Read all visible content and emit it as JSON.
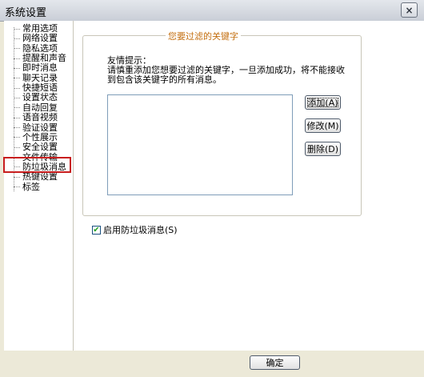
{
  "window": {
    "title": "系统设置",
    "close_glyph": "×"
  },
  "tree": {
    "items": [
      {
        "label": "常用选项"
      },
      {
        "label": "网络设置"
      },
      {
        "label": "隐私选项"
      },
      {
        "label": "提醒和声音"
      },
      {
        "label": "即时消息"
      },
      {
        "label": "聊天记录"
      },
      {
        "label": "快捷短语"
      },
      {
        "label": "设置状态"
      },
      {
        "label": "自动回复"
      },
      {
        "label": "语音视频"
      },
      {
        "label": "验证设置"
      },
      {
        "label": "个性展示"
      },
      {
        "label": "安全设置"
      },
      {
        "label": "文件传输"
      },
      {
        "label": "防垃圾消息",
        "selected": true
      },
      {
        "label": "热键设置"
      },
      {
        "label": "标签"
      }
    ],
    "highlight_color": "#c81e1e"
  },
  "group": {
    "legend": "您要过滤的关键字",
    "tip_title": "友情提示：",
    "tip_line1": "请慎重添加您想要过滤的关键字，一旦添加成功，将不能接收",
    "tip_line2": "到包含该关键字的所有消息。",
    "buttons": {
      "add": "添加(A)",
      "modify": "修改(M)",
      "delete": "删除(D)"
    }
  },
  "option": {
    "label": "启用防垃圾消息(S)",
    "checked": true
  },
  "footer": {
    "ok": "确定"
  }
}
